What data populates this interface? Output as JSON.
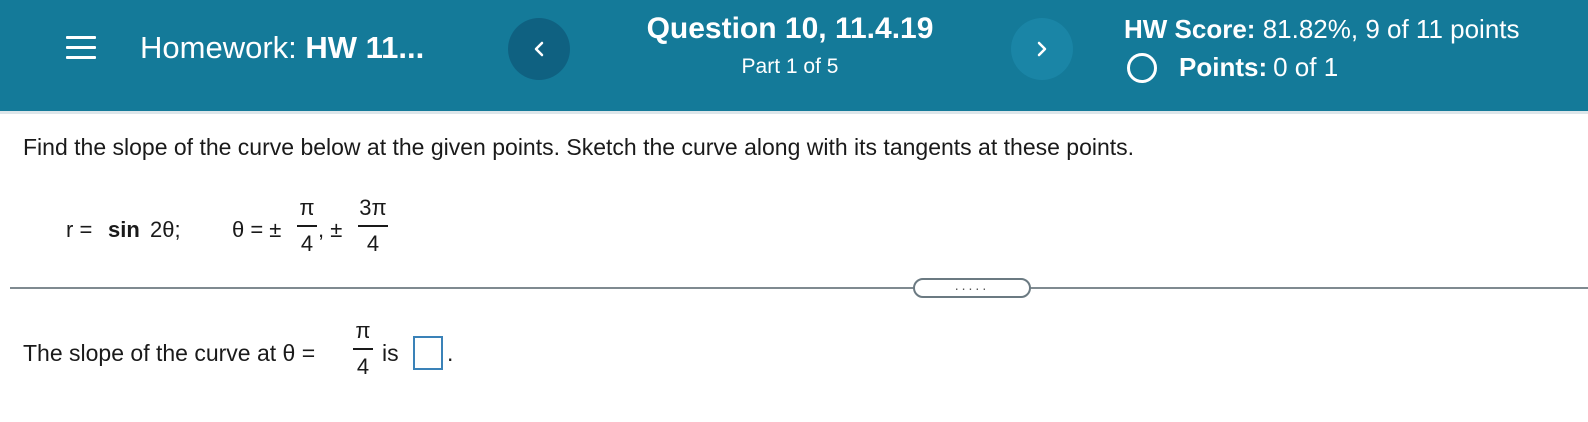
{
  "header": {
    "homework_prefix": "Homework:",
    "homework_name": "HW 11...",
    "question_title": "Question 10, 11.4.19",
    "part_label": "Part 1 of 5",
    "score_label": "HW Score:",
    "score_value": "81.82%, 9 of 11 points",
    "points_label": "Points:",
    "points_value": "0 of 1",
    "icons": {
      "menu": "hamburger-menu-icon",
      "prev": "chevron-left-icon",
      "next": "chevron-right-icon",
      "points_status": "empty-circle-icon"
    },
    "colors": {
      "bar": "#147a99",
      "prev_button": "#0f6181",
      "next_button": "#1a85a6"
    }
  },
  "problem": {
    "instructions": "Find the slope of the curve below at the given points. Sketch the curve along with its tangents at these points.",
    "equation": {
      "r_label": "r =",
      "r_func": "sin",
      "r_arg": "2θ;",
      "theta_label": "θ = ±",
      "frac1_num": "π",
      "frac1_den": "4",
      "separator": ", ±",
      "frac2_num": "3π",
      "frac2_den": "4"
    }
  },
  "expand_button": {
    "label": "....."
  },
  "answer": {
    "prefix": "The slope of the curve at θ =",
    "frac_num": "π",
    "frac_den": "4",
    "suffix": "is",
    "period": ".",
    "input_value": ""
  }
}
